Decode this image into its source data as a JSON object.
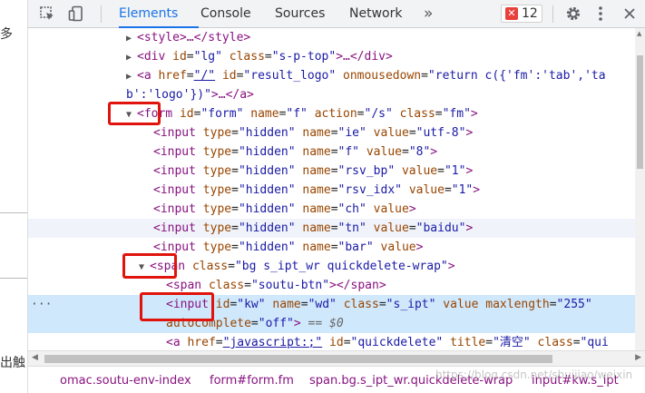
{
  "page_strip": {
    "text_top": "多",
    "text_bottom": "出触"
  },
  "toolbar": {
    "inspect_icon": "inspect-icon",
    "device_icon": "device-toggle-icon",
    "tabs": [
      {
        "label": "Elements"
      },
      {
        "label": "Console"
      },
      {
        "label": "Sources"
      },
      {
        "label": "Network"
      }
    ],
    "more_tabs": "»",
    "error_count": "12",
    "accent": "#1a73e8"
  },
  "tree": [
    {
      "open": "<",
      "tag": "style",
      "close": ">…</style>"
    },
    {
      "tag": "div",
      "id_attr": "id",
      "id_val": "\"lg\"",
      "cls_attr": "class",
      "cls_val": "\"s-p-top\"",
      "tail": ">…</div>"
    },
    {
      "tag": "a",
      "a1": "href",
      "v1": "\"/\"",
      "a2": "id",
      "v2": "\"result_logo\"",
      "a3": "onmousedown",
      "v3": "\"return c({'fm':'tab','ta"
    },
    {
      "cont": "b':'logo'})\"",
      "tail": ">…</a>"
    },
    {
      "tag": "form",
      "a1": "id",
      "v1": "\"form\"",
      "a2": "name",
      "v2": "\"f\"",
      "a3": "action",
      "v3": "\"/s\"",
      "a4": "class",
      "v4": "\"fm\""
    },
    {
      "tag": "input",
      "a1": "type",
      "v1": "\"hidden\"",
      "a2": "name",
      "v2": "\"ie\"",
      "a3": "value",
      "v3": "\"utf-8\""
    },
    {
      "tag": "input",
      "a1": "type",
      "v1": "\"hidden\"",
      "a2": "name",
      "v2": "\"f\"",
      "a3": "value",
      "v3": "\"8\""
    },
    {
      "tag": "input",
      "a1": "type",
      "v1": "\"hidden\"",
      "a2": "name",
      "v2": "\"rsv_bp\"",
      "a3": "value",
      "v3": "\"1\""
    },
    {
      "tag": "input",
      "a1": "type",
      "v1": "\"hidden\"",
      "a2": "name",
      "v2": "\"rsv_idx\"",
      "a3": "value",
      "v3": "\"1\""
    },
    {
      "tag": "input",
      "a1": "type",
      "v1": "\"hidden\"",
      "a2": "name",
      "v2": "\"ch\"",
      "a3": "value"
    },
    {
      "tag": "input",
      "a1": "type",
      "v1": "\"hidden\"",
      "a2": "name",
      "v2": "\"tn\"",
      "a3": "value",
      "v3": "\"baidu\""
    },
    {
      "tag": "input",
      "a1": "type",
      "v1": "\"hidden\"",
      "a2": "name",
      "v2": "\"bar\"",
      "a3": "value"
    },
    {
      "tag": "span",
      "a1": "class",
      "v1": "\"bg s_ipt_wr quickdelete-wrap\""
    },
    {
      "tag": "span",
      "a1": "class",
      "v1": "\"soutu-btn\"",
      "tail": "></span>"
    },
    {
      "tag": "input",
      "a1": "id",
      "v1": "\"kw\"",
      "a2": "name",
      "v2": "\"wd\"",
      "a3": "class",
      "v3": "\"s_ipt\"",
      "a4": "value",
      "a5": "maxlength",
      "v5": "\"255\""
    },
    {
      "cont_attr": "autocomplete",
      "cont_val": "\"off\"",
      "sel": "== $0"
    },
    {
      "tag": "a",
      "a1": "href",
      "v1": "\"javascript:;\"",
      "a2": "id",
      "v2": "\"quickdelete\"",
      "a3": "title",
      "v3": "\"清空\"",
      "a4": "class",
      "v4": "\"qui"
    }
  ],
  "breadcrumbs": [
    "omac.soutu-env-index",
    "form#form.fm",
    "span.bg.s_ipt_wr.quickdelete-wrap",
    "input#kw.s_ipt"
  ],
  "watermark": "https://blog.csdn.net/shuijiao/weixin"
}
